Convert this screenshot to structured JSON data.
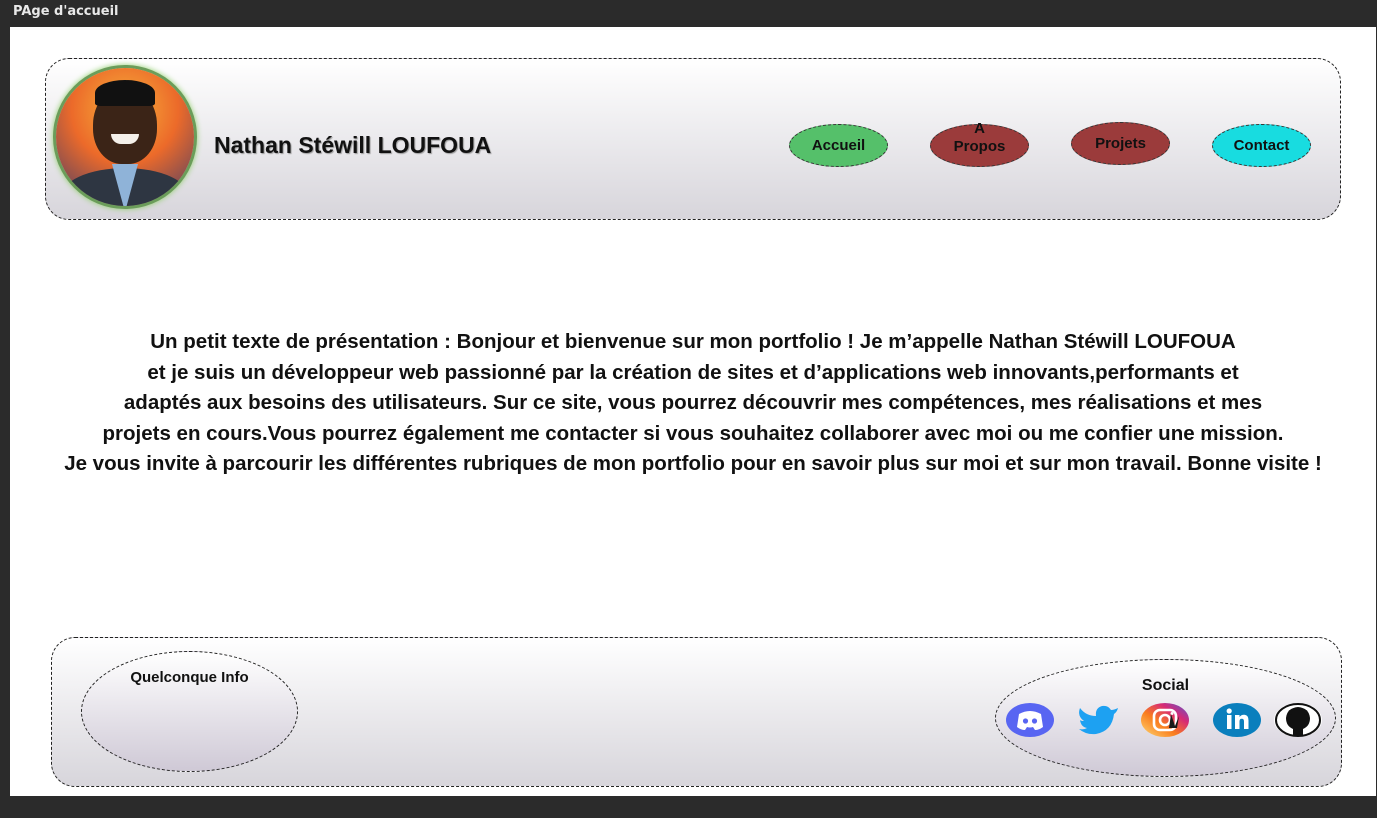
{
  "window": {
    "title": "PAge d'accueil"
  },
  "header": {
    "site_name": "Nathan Stéwill LOUFOUA",
    "nav": [
      {
        "label": "Accueil",
        "color": "#55c06a"
      },
      {
        "label": "A\nPropos",
        "color": "#9b3b3b"
      },
      {
        "label": "Projets",
        "color": "#9b3b3b"
      },
      {
        "label": "Contact",
        "color": "#18dce0"
      }
    ]
  },
  "intro": {
    "lines": [
      "Un petit texte de présentation :  Bonjour et bienvenue sur mon portfolio ! Je m’appelle Nathan Stéwill LOUFOUA",
      "et je suis un développeur web passionné par la création de sites et d’applications web innovants,performants et",
      "adaptés aux besoins des utilisateurs. Sur ce site, vous pourrez découvrir mes compétences, mes réalisations et mes",
      "projets en cours.Vous pourrez également me contacter si vous souhaitez collaborer avec moi ou me confier une mission.",
      "Je vous invite à parcourir les différentes rubriques de mon portfolio pour en savoir plus sur moi et sur mon travail. Bonne visite !"
    ]
  },
  "footer": {
    "info_label": "Quelconque Info",
    "social_label": "Social",
    "social_icons": [
      "discord-icon",
      "twitter-icon",
      "instagram-icon",
      "linkedin-icon",
      "github-icon"
    ]
  }
}
